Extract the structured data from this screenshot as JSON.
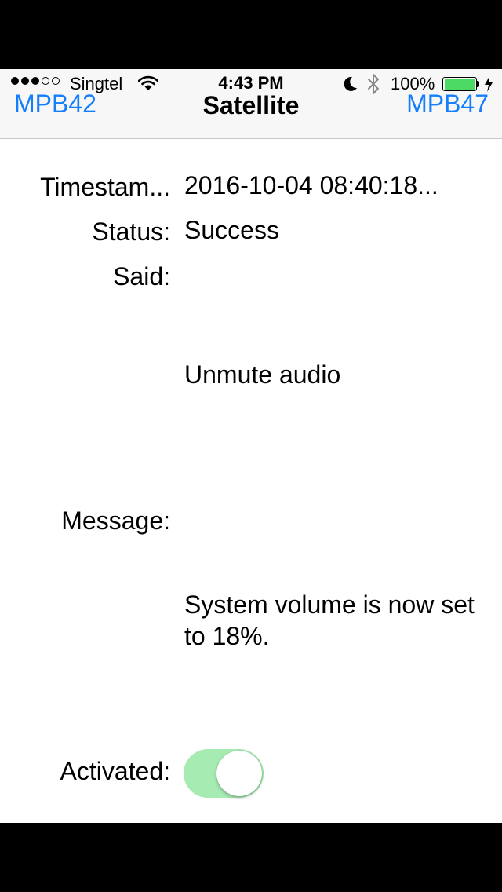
{
  "status_bar": {
    "signal_bars_filled": 3,
    "signal_bars_total": 5,
    "carrier": "Singtel",
    "wifi_icon": "wifi-icon",
    "time": "4:43 PM",
    "do_not_disturb_icon": "moon-icon",
    "bluetooth_icon": "bluetooth-icon",
    "battery_percent": "100%",
    "battery_level": 1.0,
    "battery_color": "#4cd964",
    "charging_icon": "bolt-icon"
  },
  "navbar": {
    "back_label": "MPB42",
    "title": "Satellite",
    "forward_label": "MPB47",
    "accent_color": "#157efb"
  },
  "details": {
    "timestamp_label": "Timestam...",
    "timestamp_value": "2016-10-04 08:40:18...",
    "status_label": "Status:",
    "status_value": "Success",
    "said_label": "Said:",
    "said_value": "Unmute audio",
    "message_label": "Message:",
    "message_value": "System volume is now set to 18%.",
    "activated_label": "Activated:",
    "activated_on": true,
    "toggle_color": "#a6ebb2"
  }
}
